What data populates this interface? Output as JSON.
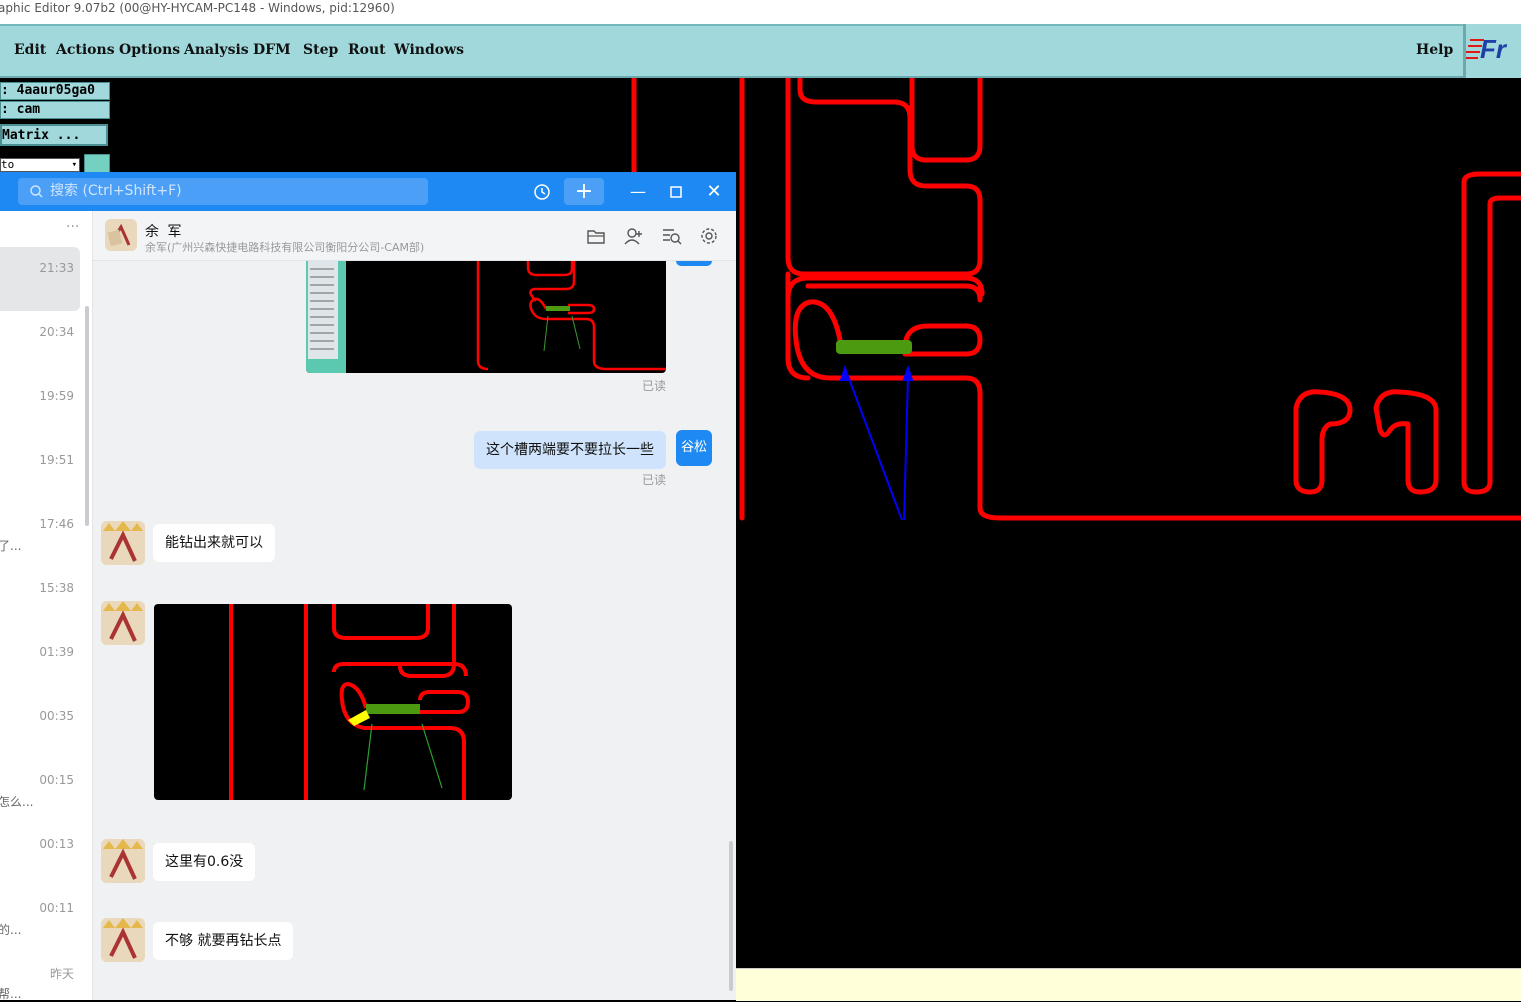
{
  "window": {
    "title": "aphic Editor 9.07b2 (00@HY-HYCAM-PC148 - Windows, pid:12960)"
  },
  "menubar": {
    "items": [
      "Edit",
      "Actions",
      "Options",
      "Analysis",
      "DFM",
      "Step",
      "Rout",
      "Windows"
    ],
    "help": "Help",
    "logo": "Fr"
  },
  "cam_panel": {
    "job": ": 4aaur05ga0",
    "user": ": cam",
    "matrix": "Matrix ...",
    "combo": "to"
  },
  "chat": {
    "search": {
      "placeholder": "搜索 (Ctrl+Shift+F)"
    },
    "sessions_more": "···",
    "sessions": [
      {
        "time": "21:33",
        "snippet": ""
      },
      {
        "time": "20:34",
        "snippet": ""
      },
      {
        "time": "19:59",
        "snippet": ""
      },
      {
        "time": "19:51",
        "snippet": ""
      },
      {
        "time": "17:46",
        "snippet": "了..."
      },
      {
        "time": "15:38",
        "snippet": ""
      },
      {
        "time": "01:39",
        "snippet": ""
      },
      {
        "time": "00:35",
        "snippet": ""
      },
      {
        "time": "00:15",
        "snippet": "怎么..."
      },
      {
        "time": "00:13",
        "snippet": ""
      },
      {
        "time": "00:11",
        "snippet": "的..."
      },
      {
        "time": "昨天",
        "snippet": "帮..."
      }
    ],
    "contact": {
      "name": "余 军",
      "subtitle": "余军(广州兴森快捷电路科技有限公司衡阳分公司-CAM部)"
    },
    "messages": {
      "read_label": "已读",
      "out_text": "这个槽两端要不要拉长一些",
      "self_avatar": "谷松",
      "in1": "能钻出来就可以",
      "in2": "这里有0.6没",
      "in3": "不够 就要再钻长点"
    }
  }
}
